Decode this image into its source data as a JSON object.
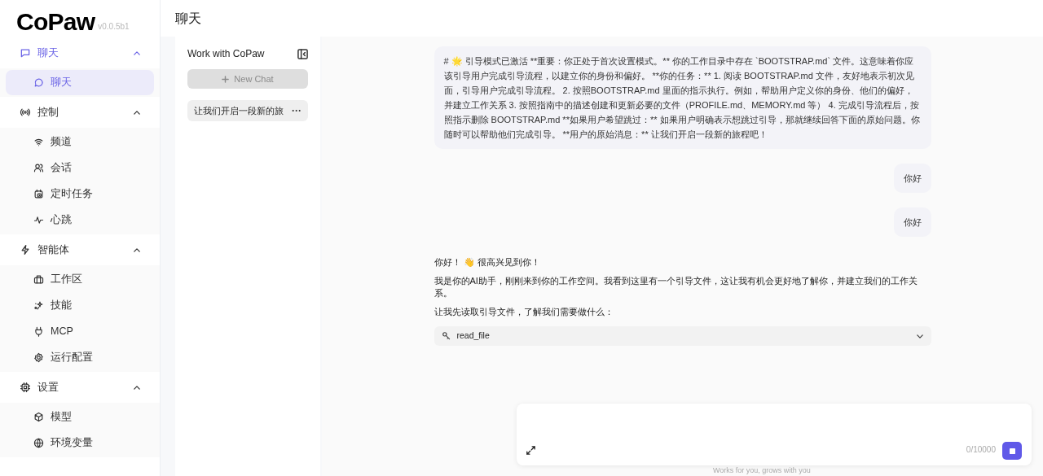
{
  "brand": {
    "logo": "CoPaw",
    "version": "v0.0.5b1"
  },
  "nav": [
    {
      "label": "聊天",
      "selected": true,
      "expanded": true,
      "children": [
        {
          "label": "聊天",
          "selected": true
        }
      ]
    },
    {
      "label": "控制",
      "selected": false,
      "expanded": true,
      "children": [
        {
          "label": "频道",
          "selected": false
        },
        {
          "label": "会话",
          "selected": false
        },
        {
          "label": "定时任务",
          "selected": false
        },
        {
          "label": "心跳",
          "selected": false
        }
      ]
    },
    {
      "label": "智能体",
      "selected": false,
      "expanded": true,
      "children": [
        {
          "label": "工作区",
          "selected": false
        },
        {
          "label": "技能",
          "selected": false
        },
        {
          "label": "MCP",
          "selected": false
        },
        {
          "label": "运行配置",
          "selected": false
        }
      ]
    },
    {
      "label": "设置",
      "selected": false,
      "expanded": true,
      "children": [
        {
          "label": "模型",
          "selected": false
        },
        {
          "label": "环境变量",
          "selected": false
        }
      ]
    }
  ],
  "page_title": "聊天",
  "sessions": {
    "title": "Work with CoPaw",
    "new_button": "New Chat",
    "new_disabled": true,
    "items": [
      {
        "label": "让我们开启一段新的旅",
        "selected": true,
        "menu": "···"
      }
    ]
  },
  "messages": [
    {
      "kind": "user",
      "paragraphs": [
        "# 🌟 引导模式已激活 **重要：你正处于首次设置模式。** 你的工作目录中存在 `BOOTSTRAP.md` 文件。这意味着你应该引导用户完成引导流程，以建立你的身份和偏好。 **你的任务：** 1. 阅读 BOOTSTRAP.md 文件，友好地表示初次见面，引导用户完成引导流程。 2. 按照BOOTSTRAP.md 里面的指示执行。例如，帮助用户定义你的身份、他们的偏好，并建立工作关系 3. 按照指南中的描述创建和更新必要的文件（PROFILE.md、MEMORY.md 等） 4. 完成引导流程后，按照指示删除 BOOTSTRAP.md **如果用户希望跳过：** 如果用户明确表示想跳过引导，那就继续回答下面的原始问题。你随时可以帮助他们完成引导。 **用户的原始消息：** 让我们开启一段新的旅程吧！"
      ]
    },
    {
      "kind": "user",
      "paragraphs": [
        "你好"
      ]
    },
    {
      "kind": "user",
      "paragraphs": [
        "你好"
      ]
    },
    {
      "kind": "assistant",
      "paragraphs": [
        "你好！ 👋 很高兴见到你！",
        "我是你的AI助手，刚刚来到你的工作空间。我看到这里有一个引导文件，这让我有机会更好地了解你，并建立我们的工作关系。",
        "让我先读取引导文件，了解我们需要做什么："
      ],
      "tool": {
        "name": "read_file",
        "expanded": false
      }
    }
  ],
  "composer": {
    "counter": "0/10000",
    "footer": "Works for you, grows with you"
  }
}
